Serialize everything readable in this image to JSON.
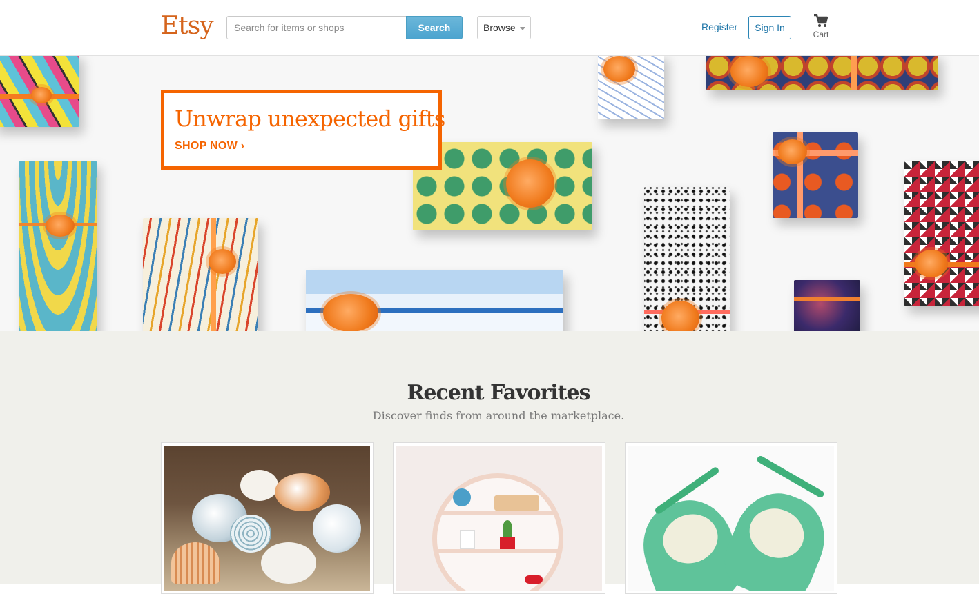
{
  "header": {
    "logo": "Etsy",
    "search_placeholder": "Search for items or shops",
    "search_label": "Search",
    "browse_label": "Browse",
    "register_label": "Register",
    "signin_label": "Sign In",
    "cart_label": "Cart",
    "cart_icon": "cart-icon"
  },
  "hero": {
    "headline": "Unwrap unexpected gifts",
    "cta": "SHOP NOW ›"
  },
  "favorites": {
    "title": "Recent Favorites",
    "subtitle": "Discover finds from around the marketplace.",
    "cards": [
      {
        "image": "seashells"
      },
      {
        "image": "round-shelf"
      },
      {
        "image": "green-shoes"
      }
    ]
  },
  "colors": {
    "brand": "#d5641c",
    "accent": "#f56400",
    "link": "#1f76a8",
    "search_button": "#4ca4cf"
  }
}
